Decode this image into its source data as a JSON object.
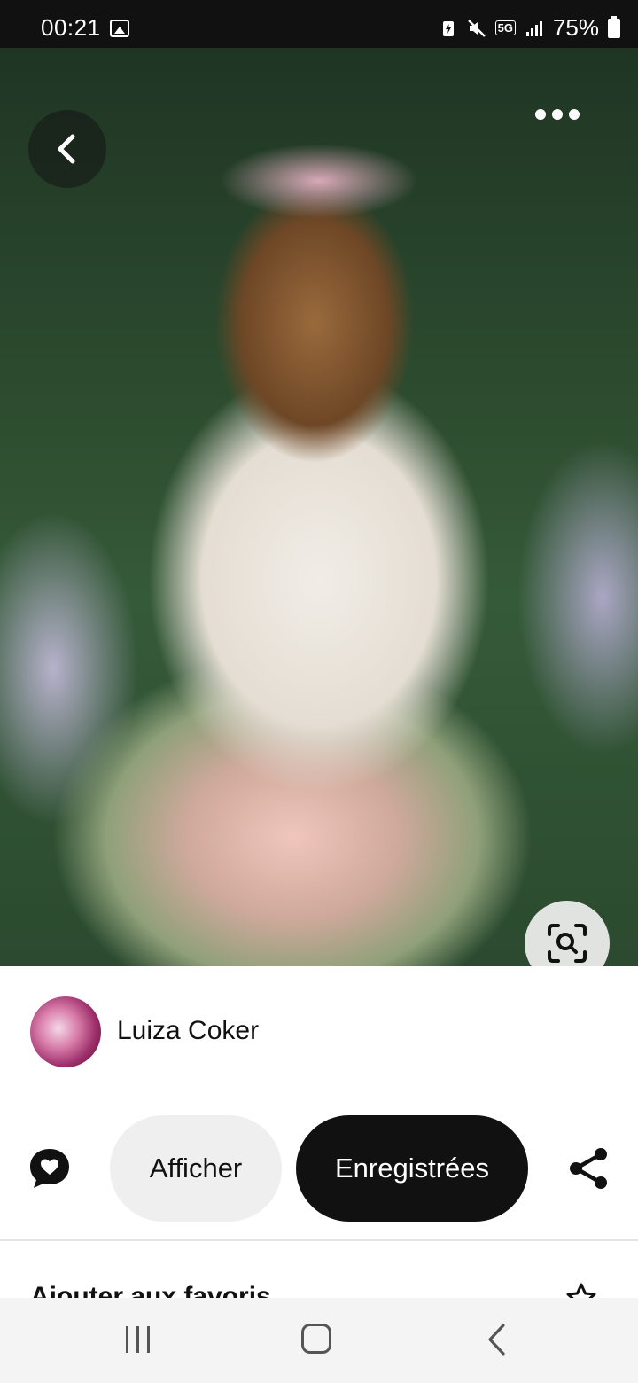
{
  "status_bar": {
    "time": "00:21",
    "network": "5G",
    "battery": "75%",
    "icons": [
      "image-icon",
      "battery-saver-icon",
      "mute-icon",
      "network-5g-icon",
      "signal-icon",
      "battery-icon"
    ]
  },
  "hero": {
    "back_icon": "chevron-left-icon",
    "more_icon": "more-dots-icon",
    "lens_icon": "visual-search-icon"
  },
  "author": {
    "name": "Luiza Coker"
  },
  "actions": {
    "comment_icon": "comment-heart-icon",
    "view_label": "Afficher",
    "saved_label": "Enregistrées",
    "share_icon": "share-icon"
  },
  "favorites": {
    "label": "Ajouter aux favoris",
    "icon": "star-icon"
  },
  "nav_bar": {
    "icons": [
      "recents-icon",
      "home-icon",
      "back-icon"
    ]
  },
  "colors": {
    "primary_button": "#111111",
    "secondary_button": "#efefef",
    "status_bar": "#111111"
  }
}
